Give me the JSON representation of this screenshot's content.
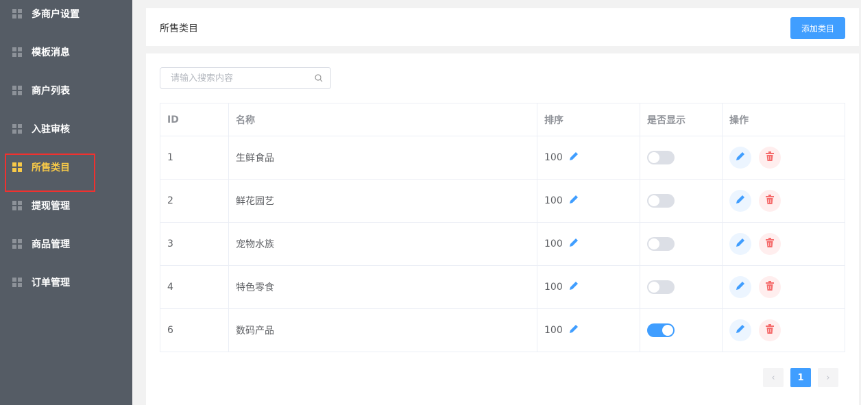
{
  "sidebar": {
    "items": [
      {
        "label": "多商户设置",
        "active": false
      },
      {
        "label": "模板消息",
        "active": false
      },
      {
        "label": "商户列表",
        "active": false
      },
      {
        "label": "入驻审核",
        "active": false
      },
      {
        "label": "所售类目",
        "active": true
      },
      {
        "label": "提现管理",
        "active": false
      },
      {
        "label": "商品管理",
        "active": false
      },
      {
        "label": "订单管理",
        "active": false
      }
    ]
  },
  "header": {
    "title": "所售类目",
    "add_label": "添加类目"
  },
  "search": {
    "placeholder": "请输入搜索内容",
    "value": ""
  },
  "table": {
    "columns": [
      "ID",
      "名称",
      "排序",
      "是否显示",
      "操作"
    ],
    "rows": [
      {
        "id": "1",
        "name": "生鲜食品",
        "sort": "100",
        "show": false
      },
      {
        "id": "2",
        "name": "鲜花园艺",
        "sort": "100",
        "show": false
      },
      {
        "id": "3",
        "name": "宠物水族",
        "sort": "100",
        "show": false
      },
      {
        "id": "4",
        "name": "特色零食",
        "sort": "100",
        "show": false
      },
      {
        "id": "6",
        "name": "数码产品",
        "sort": "100",
        "show": true
      }
    ]
  },
  "pagination": {
    "current": "1",
    "prev": "‹",
    "next": "›"
  },
  "colors": {
    "accent": "#409eff",
    "active_nav": "#f7c948",
    "delete": "#f56c6c"
  }
}
